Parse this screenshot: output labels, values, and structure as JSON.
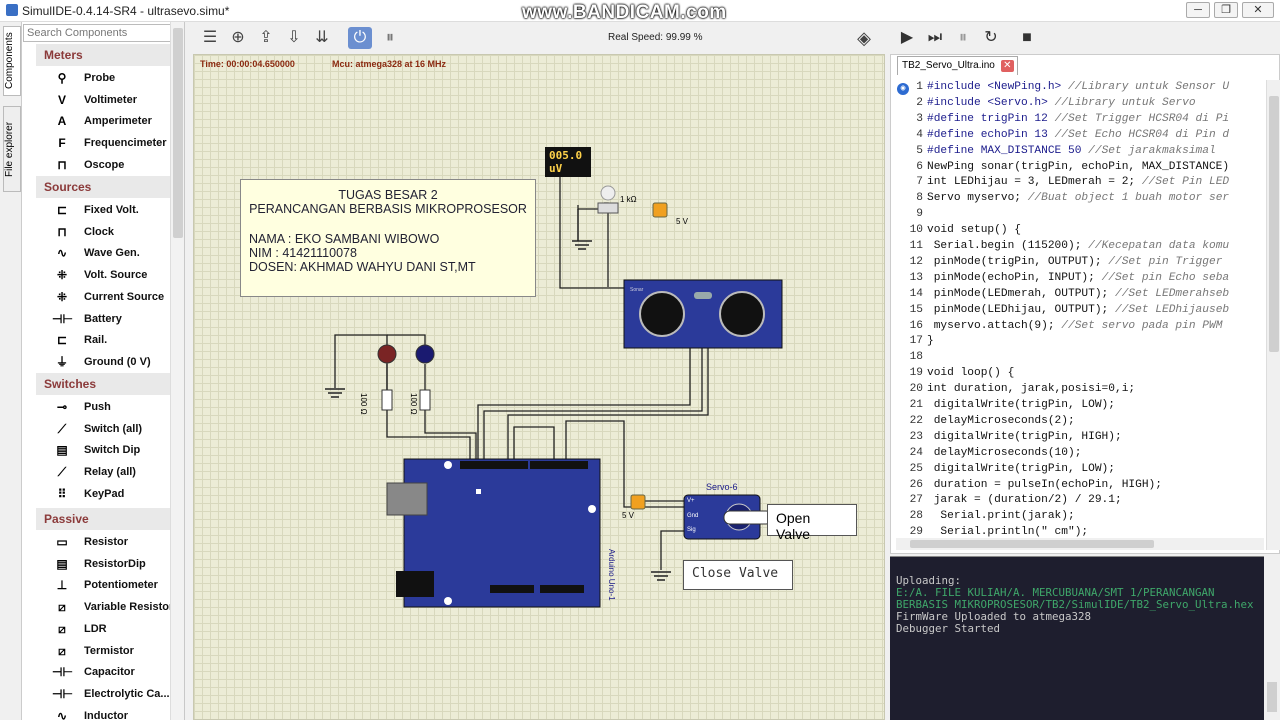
{
  "window": {
    "title": "SimulIDE-0.4.14-SR4  -  ultrasevo.simu*",
    "watermark": "www.BANDICAM.com"
  },
  "side_tabs": [
    "Components",
    "File explorer"
  ],
  "palette": {
    "search_placeholder": "Search Components",
    "categories": [
      {
        "name": "Meters",
        "items": [
          {
            "label": "Probe",
            "icon": "probe-icon",
            "glyph": "⚲"
          },
          {
            "label": "Voltimeter",
            "icon": "voltmeter-icon",
            "glyph": "V"
          },
          {
            "label": "Amperimeter",
            "icon": "ammeter-icon",
            "glyph": "A"
          },
          {
            "label": "Frequencimeter",
            "icon": "frequencymeter-icon",
            "glyph": "F"
          },
          {
            "label": "Oscope",
            "icon": "oscope-icon",
            "glyph": "⊓"
          }
        ]
      },
      {
        "name": "Sources",
        "items": [
          {
            "label": "Fixed Volt.",
            "icon": "fixed-volt-icon",
            "glyph": "⊏"
          },
          {
            "label": "Clock",
            "icon": "clock-icon",
            "glyph": "⊓"
          },
          {
            "label": "Wave Gen.",
            "icon": "wave-gen-icon",
            "glyph": "∿"
          },
          {
            "label": "Volt. Source",
            "icon": "volt-source-icon",
            "glyph": "⁜"
          },
          {
            "label": "Current Source",
            "icon": "current-source-icon",
            "glyph": "⁜"
          },
          {
            "label": "Battery",
            "icon": "battery-icon",
            "glyph": "⊣⊢"
          },
          {
            "label": "Rail.",
            "icon": "rail-icon",
            "glyph": "⊏"
          },
          {
            "label": "Ground (0 V)",
            "icon": "ground-icon",
            "glyph": "⏚"
          }
        ]
      },
      {
        "name": "Switches",
        "items": [
          {
            "label": "Push",
            "icon": "push-icon",
            "glyph": "⊸"
          },
          {
            "label": "Switch (all)",
            "icon": "switch-icon",
            "glyph": "⟋"
          },
          {
            "label": "Switch Dip",
            "icon": "switch-dip-icon",
            "glyph": "▤"
          },
          {
            "label": "Relay (all)",
            "icon": "relay-icon",
            "glyph": "⟋"
          },
          {
            "label": "KeyPad",
            "icon": "keypad-icon",
            "glyph": "⠿"
          }
        ]
      },
      {
        "name": "Passive",
        "items": [
          {
            "label": "Resistor",
            "icon": "resistor-icon",
            "glyph": "▭"
          },
          {
            "label": "ResistorDip",
            "icon": "resistor-dip-icon",
            "glyph": "▤"
          },
          {
            "label": "Potentiometer",
            "icon": "potentiometer-icon",
            "glyph": "⊥"
          },
          {
            "label": "Variable Resistor",
            "icon": "variable-resistor-icon",
            "glyph": "⧄"
          },
          {
            "label": "LDR",
            "icon": "ldr-icon",
            "glyph": "⧄"
          },
          {
            "label": "Termistor",
            "icon": "termistor-icon",
            "glyph": "⧄"
          },
          {
            "label": "Capacitor",
            "icon": "capacitor-icon",
            "glyph": "⊣⊢"
          },
          {
            "label": "Electrolytic Ca...",
            "icon": "electrolytic-icon",
            "glyph": "⊣⊢"
          },
          {
            "label": "Inductor",
            "icon": "inductor-icon",
            "glyph": "∿"
          }
        ]
      }
    ]
  },
  "toolbar": {
    "real_speed": "Real Speed: 99.99 %"
  },
  "circuit": {
    "time": "Time: 00:00:04.650000",
    "mcu": "Mcu: atmega328 at 16 MHz",
    "note": {
      "line1": "TUGAS BESAR 2",
      "line2": "PERANCANGAN BERBASIS MIKROPROSESOR",
      "line3": "NAMA : EKO SAMBANI WIBOWO",
      "line4": "NIM   : 41421110078",
      "line5": "DOSEN: AKHMAD WAHYU DANI ST,MT"
    },
    "meter_value": "005.0",
    "meter_unit": "uV",
    "pot_label": "1 kΩ",
    "source_label_1": "5 V",
    "source_label_2": "5 V",
    "res1": "100 Ω",
    "res2": "100 Ω",
    "servo_name": "Servo-6",
    "servo_pin_1": "V+",
    "servo_pin_2": "Gnd",
    "servo_pin_3": "Sig",
    "arduino_label": "Arduino Uno-1",
    "sonar_label": "Sonar",
    "open_valve": "Open Valve",
    "close_valve": "Close Valve"
  },
  "editor": {
    "tab": "TB2_Servo_Ultra.ino",
    "lines": [
      "#include <NewPing.h> //Library untuk Sensor U",
      "#include <Servo.h> //Library untuk Servo",
      "#define trigPin 12 //Set Trigger HCSR04 di Pi",
      "#define echoPin 13 //Set Echo HCSR04 di Pin d",
      "#define MAX_DISTANCE 50 //Set jarakmaksimal",
      "NewPing sonar(trigPin, echoPin, MAX_DISTANCE)",
      "int LEDhijau = 3, LEDmerah = 2; //Set Pin LED",
      "Servo myservo; //Buat object 1 buah motor ser",
      "",
      "void setup() {",
      " Serial.begin (115200); //Kecepatan data komu",
      " pinMode(trigPin, OUTPUT); //Set pin Trigger",
      " pinMode(echoPin, INPUT); //Set pin Echo seba",
      " pinMode(LEDmerah, OUTPUT); //Set LEDmerahseb",
      " pinMode(LEDhijau, OUTPUT); //Set LEDhijauseb",
      " myservo.attach(9); //Set servo pada pin PWM",
      "}",
      "",
      "void loop() {",
      "int duration, jarak,posisi=0,i;",
      " digitalWrite(trigPin, LOW);",
      " delayMicroseconds(2);",
      " digitalWrite(trigPin, HIGH);",
      " delayMicroseconds(10);",
      " digitalWrite(trigPin, LOW);",
      " duration = pulseIn(echoPin, HIGH);",
      " jarak = (duration/2) / 29.1;",
      "  Serial.print(jarak);",
      "  Serial.println(\" cm\");"
    ]
  },
  "console": {
    "lines": [
      "Uploading:",
      "E:/A. FILE KULIAH/A. MERCUBUANA/SMT 1/PERANCANGAN",
      "BERBASIS MIKROPROSESOR/TB2/SimulIDE/TB2_Servo_Ultra.hex",
      "",
      "",
      "FirmWare Uploaded to atmega328",
      "",
      "",
      "Debugger Started"
    ]
  }
}
